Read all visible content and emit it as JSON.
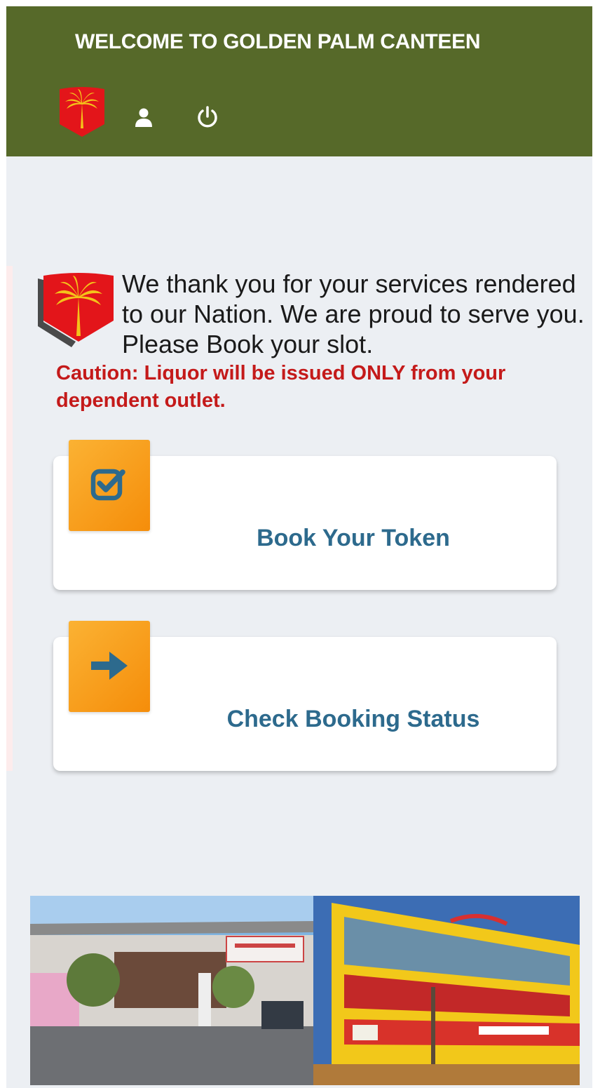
{
  "header": {
    "title": "WELCOME TO GOLDEN PALM CANTEEN",
    "bg_color": "#566929",
    "icons": [
      "palm-shield-logo",
      "user-icon",
      "power-icon"
    ]
  },
  "intro": {
    "message": "We thank you for your services rendered to our Nation. We are proud to serve you. Please Book your slot.",
    "caution": "Caution: Liquor will be issued ONLY from your dependent outlet.",
    "caution_color": "#c41a1a"
  },
  "actions": [
    {
      "label": "Book Your Token",
      "icon": "checkbox-icon"
    },
    {
      "label": "Check Booking Status",
      "icon": "arrow-right-icon"
    }
  ],
  "colors": {
    "background": "#eceff3",
    "badge": "#f7a11a",
    "action_text": "#2d6a8d"
  }
}
